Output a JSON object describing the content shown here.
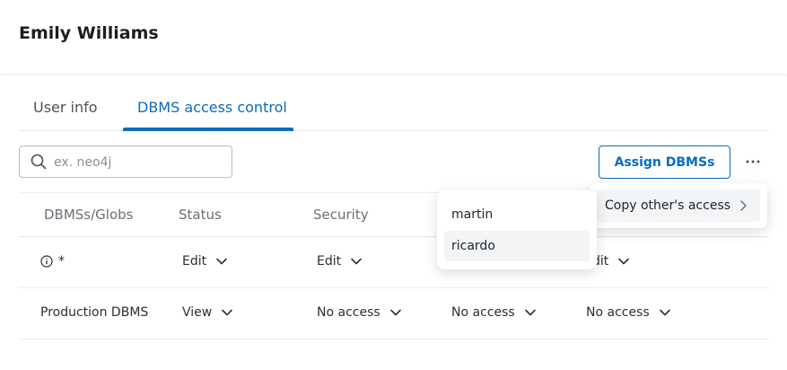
{
  "header": {
    "title": "Emily Williams"
  },
  "tabs": [
    {
      "label": "User info",
      "active": false
    },
    {
      "label": "DBMS access control",
      "active": true
    }
  ],
  "search": {
    "placeholder": "ex. neo4j",
    "value": ""
  },
  "toolbar": {
    "assign_label": "Assign DBMSs",
    "more_icon": "more-horizontal-icon"
  },
  "table": {
    "columns": [
      "DBMSs/Globs",
      "Status",
      "Security"
    ],
    "rows": [
      {
        "name": "*",
        "cells": [
          "Edit",
          "Edit",
          "",
          "dit"
        ]
      },
      {
        "name": "Production DBMS",
        "cells": [
          "View",
          "No access",
          "No access",
          "No access"
        ]
      }
    ]
  },
  "context_menu": {
    "items": [
      {
        "label": "Copy other's access"
      }
    ]
  },
  "submenu": {
    "items": [
      {
        "label": "martin"
      },
      {
        "label": "ricardo"
      }
    ]
  },
  "colors": {
    "accent": "#0a6cbd",
    "text": "#1f2329",
    "muted": "#6b7077",
    "hover": "#f2f4f6"
  }
}
